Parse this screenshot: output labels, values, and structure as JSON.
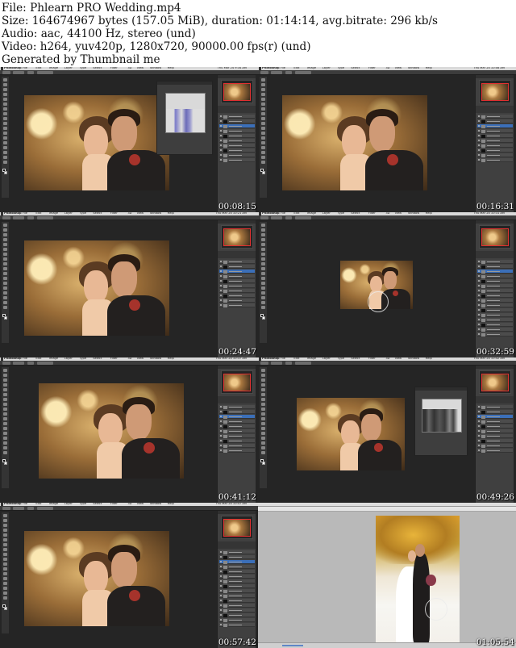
{
  "header": {
    "lines": [
      "File: Phlearn PRO Wedding.mp4",
      "Size: 164674967 bytes (157.05 MiB), duration: 01:14:14, avg.bitrate: 296 kb/s",
      "Audio: aac, 44100 Hz, stereo (und)",
      "Video: h264, yuv420p, 1280x720, 90000.00 fps(r) (und)",
      "Generated by Thumbnail me"
    ]
  },
  "app": {
    "name": "Photoshop",
    "menu": [
      "File",
      "Edit",
      "Image",
      "Layer",
      "Type",
      "Select",
      "Filter",
      "3D",
      "View",
      "Window",
      "Help"
    ]
  },
  "thumbnails": [
    {
      "timestamp": "00:08:15",
      "clock": "Thu Mar 24  9:34 AM",
      "view": "portrait",
      "panel": "curves"
    },
    {
      "timestamp": "00:16:31",
      "clock": "Thu Mar 24 10:08 AM",
      "view": "portrait",
      "panel": "none"
    },
    {
      "timestamp": "00:24:47",
      "clock": "Thu Mar 24 10:21 AM",
      "view": "portrait",
      "panel": "none"
    },
    {
      "timestamp": "00:32:59",
      "clock": "Thu Mar 24 10:31 AM",
      "view": "portrait-small",
      "panel": "none"
    },
    {
      "timestamp": "00:41:12",
      "clock": "Thu Mar 24 10:37 AM",
      "view": "portrait",
      "panel": "none"
    },
    {
      "timestamp": "00:49:26",
      "clock": "Thu Mar 24 10:42 AM",
      "view": "portrait",
      "panel": "histogram"
    },
    {
      "timestamp": "00:57:42",
      "clock": "Thu Mar 24 10:47 AM",
      "view": "portrait",
      "panel": "none"
    },
    {
      "timestamp": "01:05:54",
      "clock": "Thu Mar 24 10:56 AM",
      "view": "standing-couple",
      "panel": "none"
    }
  ]
}
